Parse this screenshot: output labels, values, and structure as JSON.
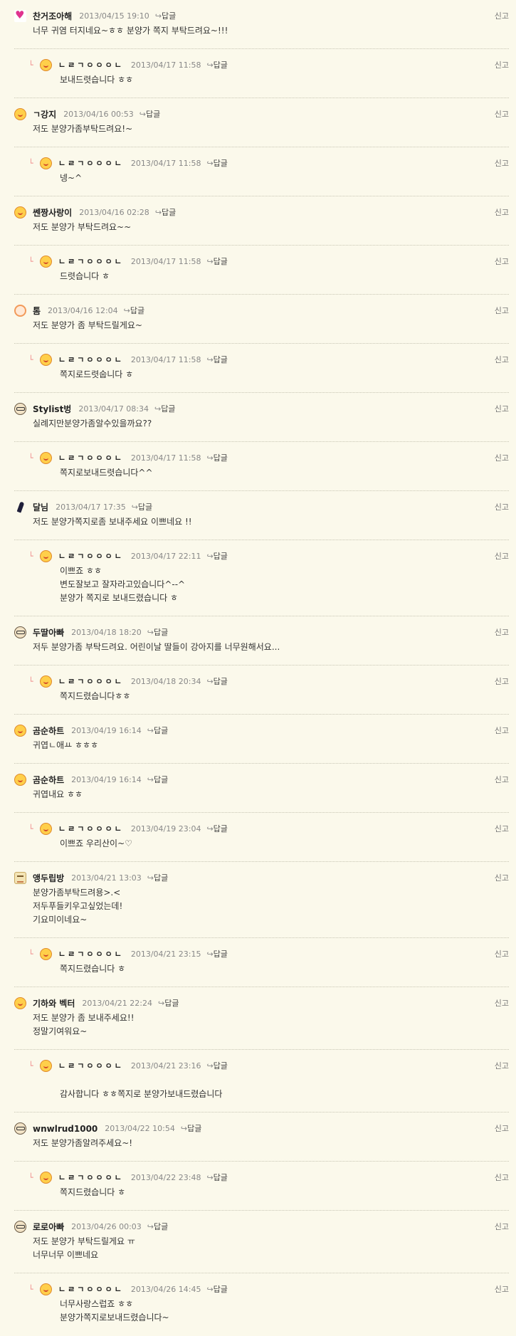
{
  "ui": {
    "reply_label": "답글",
    "report_label": "신고"
  },
  "comments": [
    {
      "kind": "top",
      "avatar": "pink-heart-icon",
      "author": "찬거조아해",
      "date": "2013/04/15 19:10",
      "lines": [
        "너무 귀염 터지네요~ㅎㅎ 분양가 쪽지 부탁드려요~!!!"
      ]
    },
    {
      "kind": "reply",
      "avatar": "yellow-face-icon",
      "author": "ㄴㄹㄱㅇㅇㅇㄴ",
      "date": "2013/04/17 11:58",
      "lines": [
        "보내드렷습니다 ㅎㅎ"
      ]
    },
    {
      "kind": "top",
      "avatar": "yellow-face-icon",
      "author": "ㄱ강지",
      "date": "2013/04/16 00:53",
      "lines": [
        "저도 분양가좀부탁드려요!~"
      ]
    },
    {
      "kind": "reply",
      "avatar": "yellow-face-icon",
      "author": "ㄴㄹㄱㅇㅇㅇㄴ",
      "date": "2013/04/17 11:58",
      "lines": [
        "넹~^"
      ]
    },
    {
      "kind": "top",
      "avatar": "yellow-face-icon",
      "author": "쎈짱사랑이",
      "date": "2013/04/16 02:28",
      "lines": [
        "저도 분양가 부탁드려요~~"
      ]
    },
    {
      "kind": "reply",
      "avatar": "yellow-face-icon",
      "author": "ㄴㄹㄱㅇㅇㅇㄴ",
      "date": "2013/04/17 11:58",
      "lines": [
        "드렷습니다 ㅎ"
      ]
    },
    {
      "kind": "top",
      "avatar": "flower-face-icon",
      "author": "톰",
      "date": "2013/04/16 12:04",
      "lines": [
        "저도 분양가 좀 부탁드릴게요~"
      ]
    },
    {
      "kind": "reply",
      "avatar": "yellow-face-icon",
      "author": "ㄴㄹㄱㅇㅇㅇㄴ",
      "date": "2013/04/17 11:58",
      "lines": [
        "쪽지로드렷숩니다 ㅎ"
      ]
    },
    {
      "kind": "top",
      "avatar": "glasses-face-icon",
      "author": "Stylist벙",
      "date": "2013/04/17 08:34",
      "lines": [
        "실례지만분양가좀알수있을까요??"
      ]
    },
    {
      "kind": "reply",
      "avatar": "yellow-face-icon",
      "author": "ㄴㄹㄱㅇㅇㅇㄴ",
      "date": "2013/04/17 11:58",
      "lines": [
        "쪽지로보내드렷습니다^^"
      ]
    },
    {
      "kind": "top",
      "avatar": "dark-figure-icon",
      "author": "달님",
      "date": "2013/04/17 17:35",
      "lines": [
        "저도 분양가쪽지로좀 보내주세요 이쁘네요 !!"
      ]
    },
    {
      "kind": "reply",
      "avatar": "yellow-face-icon",
      "author": "ㄴㄹㄱㅇㅇㅇㄴ",
      "date": "2013/04/17 22:11",
      "lines": [
        "이쁘죠 ㅎㅎ",
        "변도잘보고 잘자라고있습니다^--^",
        "분양가 쪽지로 보내드렸습니다 ㅎ"
      ]
    },
    {
      "kind": "top",
      "avatar": "glasses-face-icon",
      "author": "두딸아빠",
      "date": "2013/04/18 18:20",
      "lines": [
        "저두 분양가좀 부탁드려요. 어린이날 딸들이 강아지를 너무원해서요..."
      ]
    },
    {
      "kind": "reply",
      "avatar": "yellow-face-icon",
      "author": "ㄴㄹㄱㅇㅇㅇㄴ",
      "date": "2013/04/18 20:34",
      "lines": [
        "쪽지드렸습니다ㅎㅎ"
      ]
    },
    {
      "kind": "top",
      "avatar": "yellow-face-icon",
      "author": "곰순하트",
      "date": "2013/04/19 16:14",
      "lines": [
        "귀엽ㄴ애ㅛ ㅎㅎㅎ"
      ]
    },
    {
      "kind": "top",
      "avatar": "yellow-face-icon",
      "author": "곰순하트",
      "date": "2013/04/19 16:14",
      "lines": [
        "귀엽내요 ㅎㅎ"
      ]
    },
    {
      "kind": "reply",
      "avatar": "yellow-face-icon",
      "author": "ㄴㄹㄱㅇㅇㅇㄴ",
      "date": "2013/04/19 23:04",
      "lines": [
        "이쁘죠 우리산이~♡"
      ]
    },
    {
      "kind": "top",
      "avatar": "pixel-square-icon",
      "author": "앵두립방",
      "date": "2013/04/21 13:03",
      "lines": [
        "분양가좀부탁드려용>.<",
        "저두푸들키우고싶었는데!",
        "기요미이네요~"
      ]
    },
    {
      "kind": "reply",
      "avatar": "yellow-face-icon",
      "author": "ㄴㄹㄱㅇㅇㅇㄴ",
      "date": "2013/04/21 23:15",
      "lines": [
        "쪽지드렸습니다 ㅎ"
      ]
    },
    {
      "kind": "top",
      "avatar": "yellow-face-icon",
      "author": "기하와 벡터",
      "date": "2013/04/21 22:24",
      "lines": [
        "저도 분양가 좀 보내주세요!!",
        "정말기여워요~"
      ]
    },
    {
      "kind": "reply",
      "avatar": "yellow-face-icon",
      "author": "ㄴㄹㄱㅇㅇㅇㄴ",
      "date": "2013/04/21 23:16",
      "lines": [
        "",
        "감사합니다 ㅎㅎ쪽지로 분양가보내드렸습니다"
      ]
    },
    {
      "kind": "top",
      "avatar": "glasses-face-icon",
      "author": "wnwlrud1000",
      "date": "2013/04/22 10:54",
      "lines": [
        "저도 분양가좀알려주세요~!"
      ]
    },
    {
      "kind": "reply",
      "avatar": "yellow-face-icon",
      "author": "ㄴㄹㄱㅇㅇㅇㄴ",
      "date": "2013/04/22 23:48",
      "lines": [
        "쪽지드렸습니다 ㅎ"
      ]
    },
    {
      "kind": "top",
      "avatar": "glasses-face-icon",
      "author": "로로아빠",
      "date": "2013/04/26 00:03",
      "lines": [
        "저도 분양가 부탁드릴게요 ㅠ",
        "너무너무 이쁘네요"
      ]
    },
    {
      "kind": "reply",
      "avatar": "yellow-face-icon",
      "author": "ㄴㄹㄱㅇㅇㅇㄴ",
      "date": "2013/04/26 14:45",
      "lines": [
        "너무사랑스럽죠 ㅎㅎ",
        "분양가쪽지로보내드렸습니다~"
      ]
    }
  ]
}
